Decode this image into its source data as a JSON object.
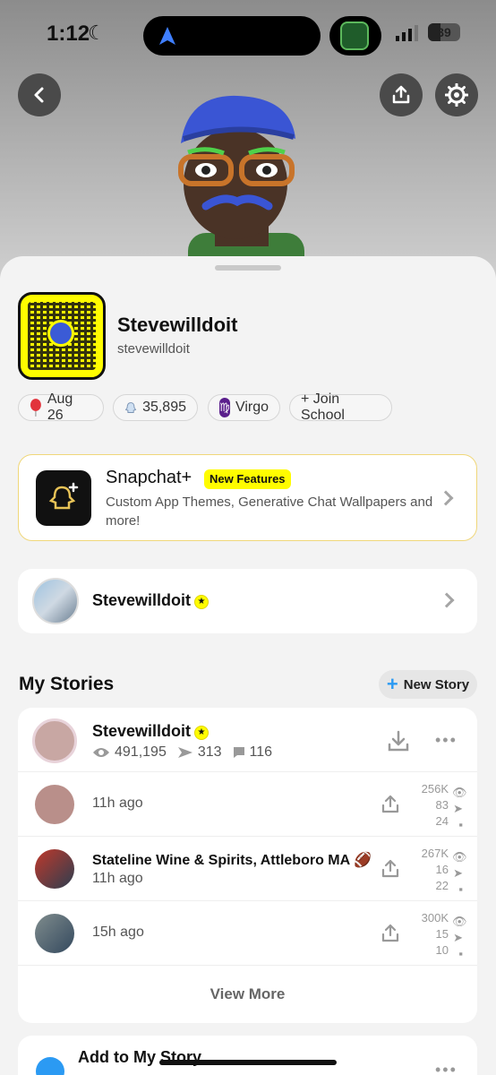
{
  "status_bar": {
    "time": "1:12",
    "battery": "39"
  },
  "profile": {
    "display_name": "Stevewilldoit",
    "username": "stevewilldoit"
  },
  "chips": {
    "birthday": "Aug 26",
    "snap_score": "35,895",
    "zodiac": "Virgo",
    "school": "+ Join School"
  },
  "snapchat_plus": {
    "title": "Snapchat+",
    "badge": "New Features",
    "description": "Custom App Themes, Generative Chat Wallpapers and more!"
  },
  "friend_card": {
    "name": "Stevewilldoit"
  },
  "my_stories": {
    "title": "My Stories",
    "new_story_label": "New Story",
    "owner": {
      "name": "Stevewilldoit",
      "views": "491,195",
      "screenshots": "313",
      "replies": "116"
    },
    "rows": [
      {
        "title": "",
        "time": "11h ago",
        "views": "256K",
        "shares": "83",
        "replies": "24"
      },
      {
        "title": "Stateline Wine & Spirits, Attleboro MA 🏈",
        "time": "11h ago",
        "views": "267K",
        "shares": "16",
        "replies": "22"
      },
      {
        "title": "",
        "time": "15h ago",
        "views": "300K",
        "shares": "15",
        "replies": "10"
      }
    ],
    "view_more_label": "View More"
  },
  "add_story": {
    "title": "Add to My Story"
  },
  "colors": {
    "snap_yellow": "#fffc00",
    "accent_blue": "#2b9af3",
    "zodiac_purple": "#5a1e8c"
  }
}
